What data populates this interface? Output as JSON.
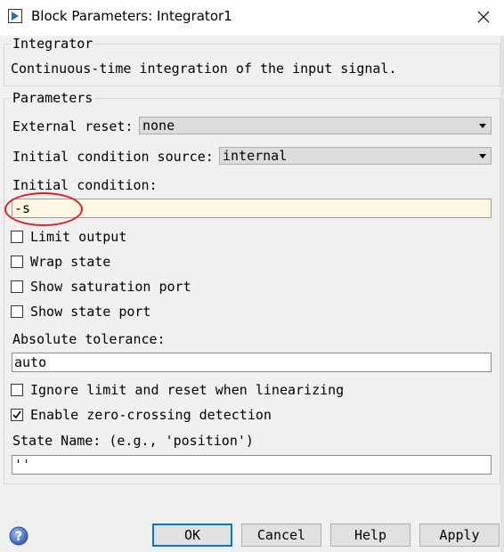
{
  "window": {
    "title": "Block Parameters: Integrator1"
  },
  "description_group": {
    "legend": "Integrator",
    "text": "Continuous-time integration of the input signal."
  },
  "parameters_group": {
    "legend": "Parameters",
    "external_reset": {
      "label": "External reset:",
      "value": "none"
    },
    "ic_source": {
      "label": "Initial condition source:",
      "value": "internal"
    },
    "initial_condition": {
      "label": "Initial condition:",
      "value": "-s"
    },
    "checkboxes": [
      {
        "label": "Limit output",
        "checked": false
      },
      {
        "label": "Wrap state",
        "checked": false
      },
      {
        "label": "Show saturation port",
        "checked": false
      },
      {
        "label": "Show state port",
        "checked": false
      }
    ],
    "absolute_tolerance": {
      "label": "Absolute tolerance:",
      "value": "auto"
    },
    "checkboxes2": [
      {
        "label": "Ignore limit and reset when linearizing",
        "checked": false
      },
      {
        "label": "Enable zero-crossing detection",
        "checked": true
      }
    ],
    "state_name": {
      "label": "State Name: (e.g., 'position')",
      "value": "''"
    }
  },
  "buttons": {
    "ok": "OK",
    "cancel": "Cancel",
    "help": "Help",
    "apply": "Apply"
  },
  "colors": {
    "annotation": "#e02020",
    "default_button_border": "#0078d7",
    "help_icon": "#3a6fc4"
  }
}
